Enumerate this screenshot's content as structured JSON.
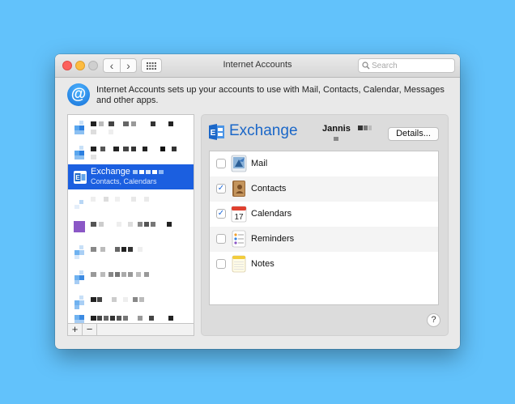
{
  "window": {
    "title": "Internet Accounts"
  },
  "search": {
    "placeholder": "Search"
  },
  "header": {
    "description": "Internet Accounts sets up your accounts to use with Mail, Contacts, Calendar, Messages and other apps."
  },
  "sidebar": {
    "selected": {
      "title": "Exchange",
      "subtitle": "Contacts, Calendars"
    },
    "add_label": "+",
    "remove_label": "−"
  },
  "account": {
    "service": "Exchange",
    "user": "Jannis",
    "details_label": "Details..."
  },
  "apps": [
    {
      "label": "Mail",
      "checked": false,
      "icon": "mail-icon"
    },
    {
      "label": "Contacts",
      "checked": true,
      "icon": "contacts-icon"
    },
    {
      "label": "Calendars",
      "checked": true,
      "icon": "calendar-icon",
      "icon_text": "17"
    },
    {
      "label": "Reminders",
      "checked": false,
      "icon": "reminders-icon"
    },
    {
      "label": "Notes",
      "checked": false,
      "icon": "notes-icon"
    }
  ],
  "help": {
    "label": "?"
  },
  "colors": {
    "desktop": "#62c2fb",
    "selection": "#1b5fe0",
    "exchange_blue": "#1b67c8",
    "checkbox_blue": "#1a66d9"
  }
}
